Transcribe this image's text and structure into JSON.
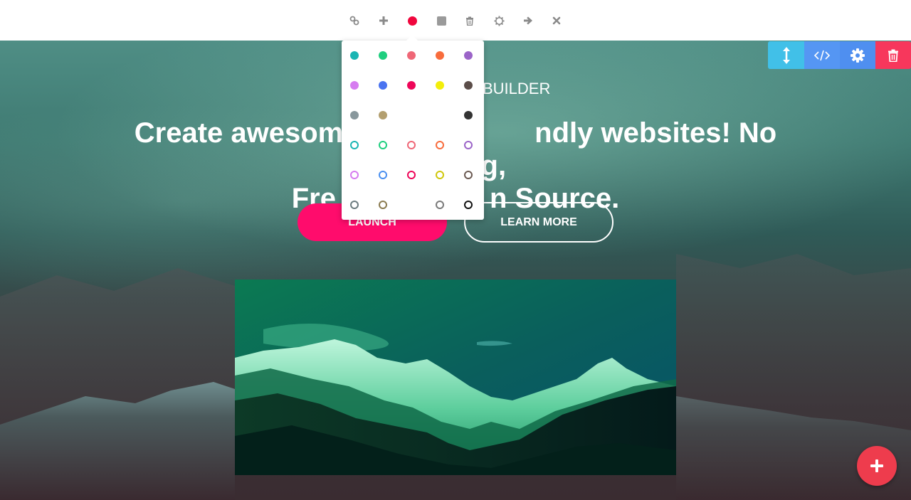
{
  "toolbar": {
    "items": [
      {
        "icon": "link-icon"
      },
      {
        "icon": "plus-icon"
      },
      {
        "icon": "color-dot-icon",
        "color": "#f0063d"
      },
      {
        "icon": "square-icon"
      },
      {
        "icon": "trash-icon"
      },
      {
        "icon": "gear-icon"
      },
      {
        "icon": "arrow-right-icon"
      },
      {
        "icon": "close-icon"
      }
    ]
  },
  "color_picker": {
    "rows": [
      [
        "#1ab5b3",
        "#1fcf7f",
        "#ef6777",
        "#f86c3c",
        "#9b64c8"
      ],
      [
        "#d67cf0",
        "#4a73f0",
        "#ee0659",
        "#f3ee0b",
        "#5b4d49"
      ],
      [
        "#88979c",
        "#b39f6f",
        "",
        "",
        "#333333"
      ]
    ],
    "outline_rows": [
      [
        "#1ab5b3",
        "#1fcf7f",
        "#ef6777",
        "#f86c3c",
        "#9b64c8"
      ],
      [
        "#d67cf0",
        "#4a8ff0",
        "#ee0659",
        "#cfc70b",
        "#6b5a52"
      ],
      [
        "#6b7b7f",
        "#8a7a4f",
        "",
        "#7a7a7a",
        "#111111"
      ]
    ]
  },
  "section_tools": {
    "items": [
      {
        "icon": "move-vertical-icon",
        "color": "#41c0e8"
      },
      {
        "icon": "code-icon",
        "color": "#5596f3"
      },
      {
        "icon": "gear-icon",
        "color": "#4f8ff0"
      },
      {
        "icon": "trash-icon",
        "color": "#f7375c"
      }
    ]
  },
  "hero": {
    "brand_visible": "BUILDER",
    "headline_line1": "Create awesome m",
    "headline_line1_end": "ndly websites! No coding,",
    "headline_line2": "Fre",
    "headline_line2_end": "n Source.",
    "launch_label": "LAUNCH",
    "learn_more_label": "LEARN MORE"
  },
  "fab": {
    "icon": "plus-icon",
    "color": "#ee3c4d"
  }
}
